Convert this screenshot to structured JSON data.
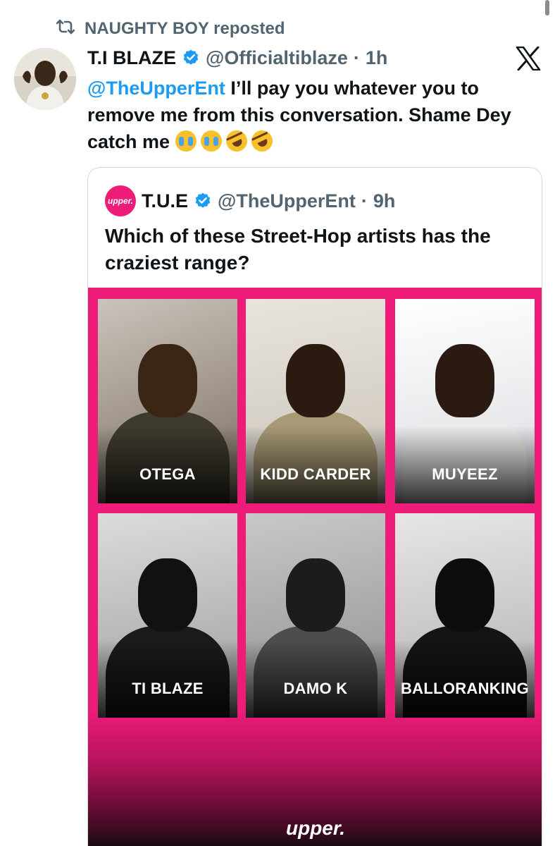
{
  "repost": {
    "label": "NAUGHTY BOY reposted",
    "icon": "repost-icon"
  },
  "tweet": {
    "display_name": "T.I BLAZE",
    "handle": "@Officialtiblaze",
    "separator": "·",
    "time": "1h",
    "mention": "@TheUpperEnt",
    "text": " I’ll pay you whatever you  to remove me from this  conversation. Shame Dey catch me ",
    "emojis": [
      "crying-face",
      "crying-face",
      "rofl-face",
      "rofl-face"
    ],
    "verified_icon": "verified-badge-icon",
    "platform_icon": "x-logo-icon"
  },
  "quote": {
    "avatar_text": "upper.",
    "display_name": "T.U.E",
    "handle": "@TheUpperEnt",
    "separator": "·",
    "time": "9h",
    "text": "Which of these Street-Hop artists has the craziest range?",
    "poster": {
      "accent_color": "#ec1c78",
      "artists": [
        "OTEGA",
        "KIDD CARDER",
        "MUYEEZ",
        "TI BLAZE",
        "DAMO K",
        "BALLORANKING"
      ],
      "logo": "upper."
    }
  },
  "colors": {
    "link": "#1d9bf0",
    "secondary_text": "#536471",
    "verified": "#1d9bf0",
    "brand_pink": "#ec1c78"
  }
}
